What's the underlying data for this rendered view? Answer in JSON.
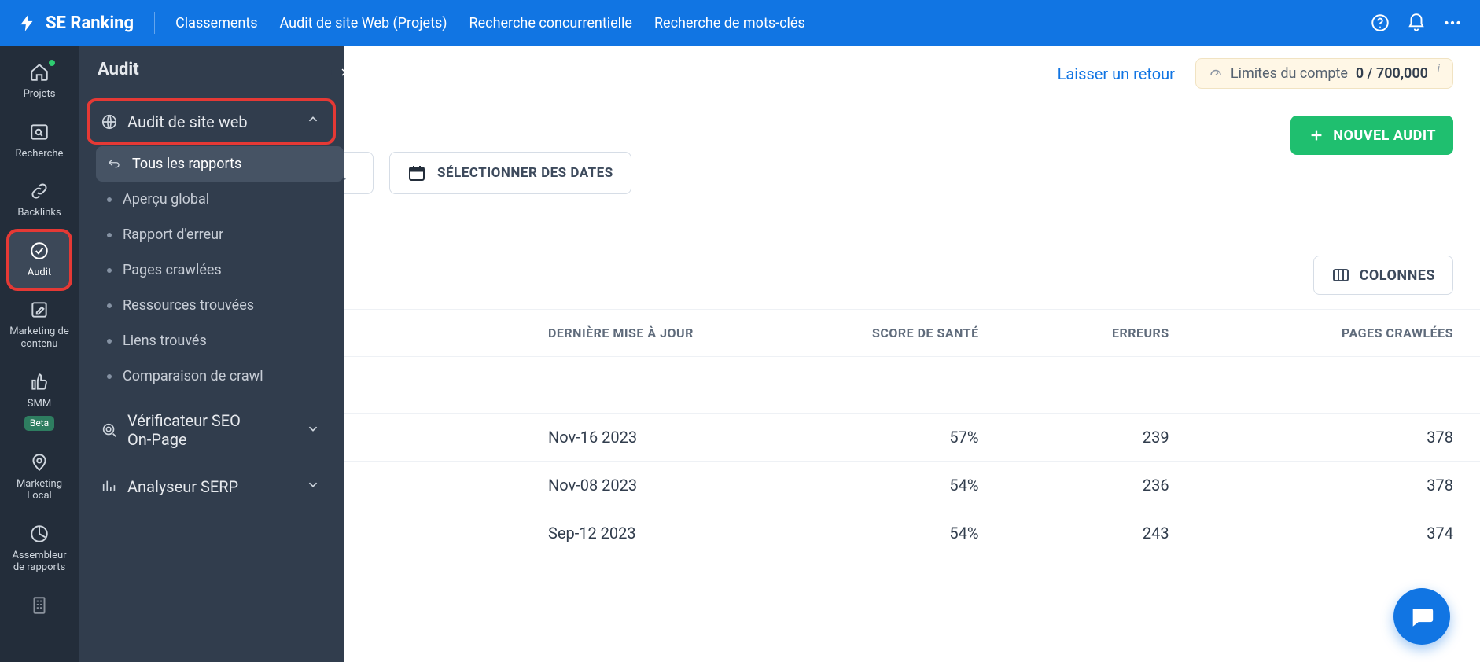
{
  "brand": "SE Ranking",
  "topnav": [
    "Classements",
    "Audit de site Web (Projets)",
    "Recherche concurrentielle",
    "Recherche de mots-clés"
  ],
  "rail": [
    {
      "id": "projets",
      "label": "Projets",
      "dot": true
    },
    {
      "id": "recherche",
      "label": "Recherche"
    },
    {
      "id": "backlinks",
      "label": "Backlinks"
    },
    {
      "id": "audit",
      "label": "Audit",
      "active": true
    },
    {
      "id": "marketing-contenu",
      "label": "Marketing de contenu"
    },
    {
      "id": "smm",
      "label": "SMM",
      "beta": "Beta"
    },
    {
      "id": "marketing-local",
      "label": "Marketing Local"
    },
    {
      "id": "assembleur",
      "label": "Assembleur de rapports"
    }
  ],
  "panel": {
    "title": "Audit",
    "group1": {
      "label": "Audit de site web"
    },
    "sub": [
      {
        "label": "Tous les rapports",
        "sel": true,
        "icon": "up-left"
      },
      {
        "label": "Aperçu global"
      },
      {
        "label": "Rapport d'erreur"
      },
      {
        "label": "Pages crawlées"
      },
      {
        "label": "Ressources trouvées"
      },
      {
        "label": "Liens trouvés"
      },
      {
        "label": "Comparaison de crawl"
      }
    ],
    "group2": {
      "label": "Vérificateur SEO On-Page"
    },
    "group3": {
      "label": "Analyseur SERP"
    }
  },
  "feedback": "Laisser un retour",
  "limits": {
    "label": "Limites du compte",
    "value": "0 / 700,000"
  },
  "newAudit": "NOUVEL AUDIT",
  "datePicker": "SÉLECTIONNER DES DATES",
  "columnsBtn": "COLONNES",
  "table": {
    "headers": {
      "update": "DERNIÈRE MISE À JOUR",
      "health": "SCORE DE SANTÉ",
      "errors": "ERREURS",
      "pages": "PAGES CRAWLÉES"
    },
    "rows": [
      {
        "update": "Nov-16 2023",
        "health": "57%",
        "errors": "239",
        "pages": "378"
      },
      {
        "update": "Nov-08 2023",
        "health": "54%",
        "errors": "236",
        "pages": "378"
      },
      {
        "update": "Sep-12 2023",
        "health": "54%",
        "errors": "243",
        "pages": "374"
      }
    ]
  }
}
